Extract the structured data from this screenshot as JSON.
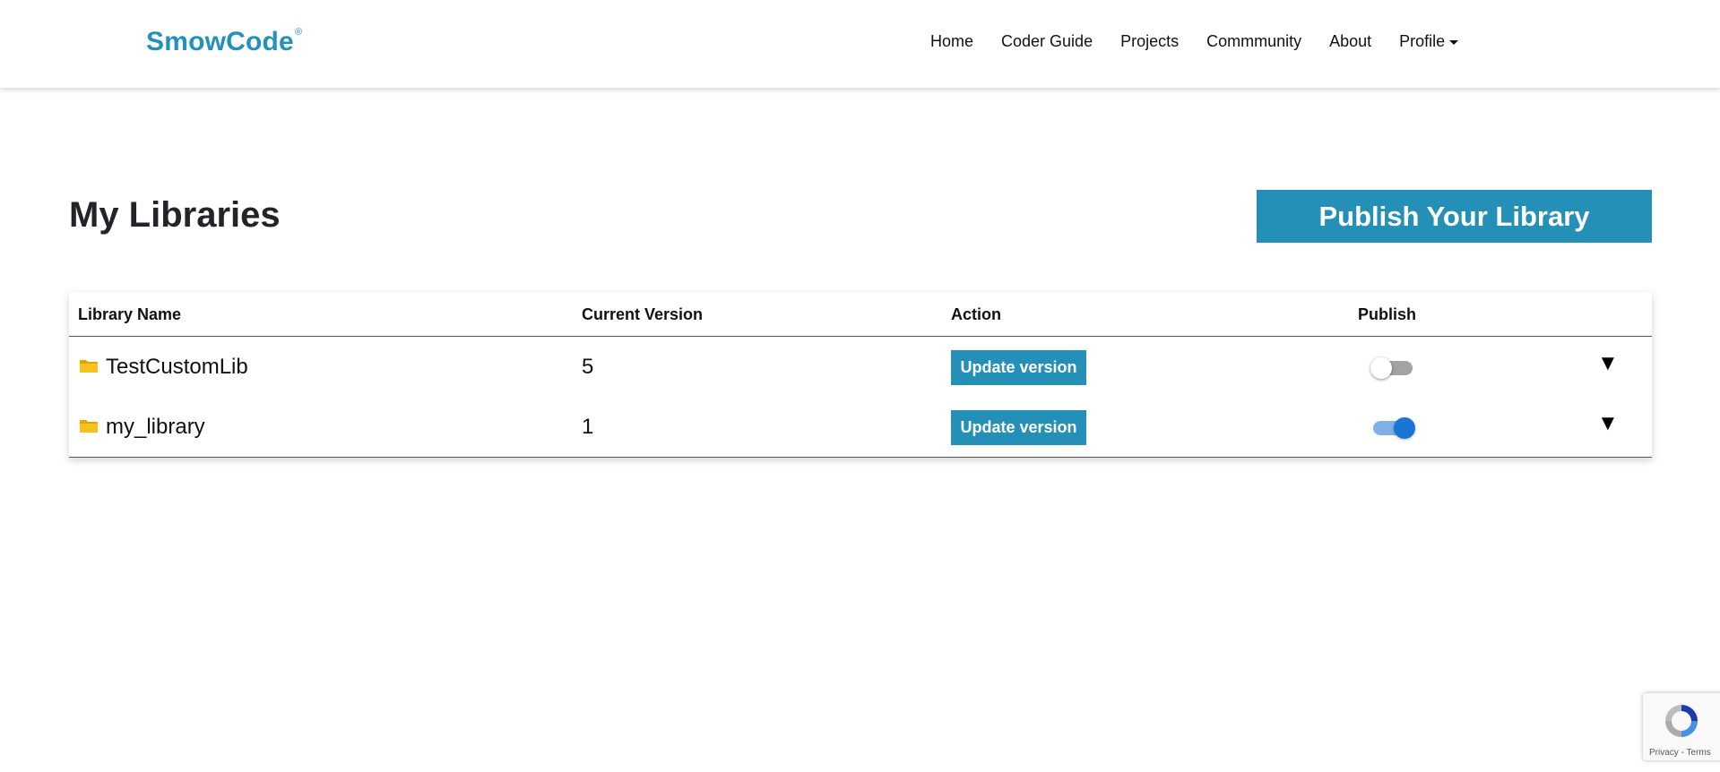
{
  "brand": {
    "name": "SmowCode",
    "mark": "®"
  },
  "nav": {
    "items": [
      {
        "label": "Home"
      },
      {
        "label": "Coder Guide"
      },
      {
        "label": "Projects"
      },
      {
        "label": "Commmunity"
      },
      {
        "label": "About"
      },
      {
        "label": "Profile"
      }
    ]
  },
  "page": {
    "title": "My Libraries",
    "publish_button": "Publish Your Library"
  },
  "table": {
    "headers": [
      "Library Name",
      "Current Version",
      "Action",
      "Publish"
    ],
    "rows": [
      {
        "name": "TestCustomLib",
        "version": "5",
        "action": "Update version",
        "published": false,
        "expand": "▼"
      },
      {
        "name": "my_library",
        "version": "1",
        "action": "Update version",
        "published": true,
        "expand": "▼"
      }
    ]
  },
  "recaptcha": {
    "privacy": "Privacy",
    "separator": "-",
    "terms": "Terms"
  },
  "colors": {
    "brand": "#2291bd",
    "button": "#2490b8",
    "toggle_on": "#1976d2",
    "toggle_off": "#a3a3a3",
    "folder": "#f5b400"
  },
  "icons": {
    "folder": "folder-icon",
    "caret": "caret-down-icon",
    "expand": "expand-triangle-icon",
    "recaptcha": "recaptcha-logo-icon"
  }
}
